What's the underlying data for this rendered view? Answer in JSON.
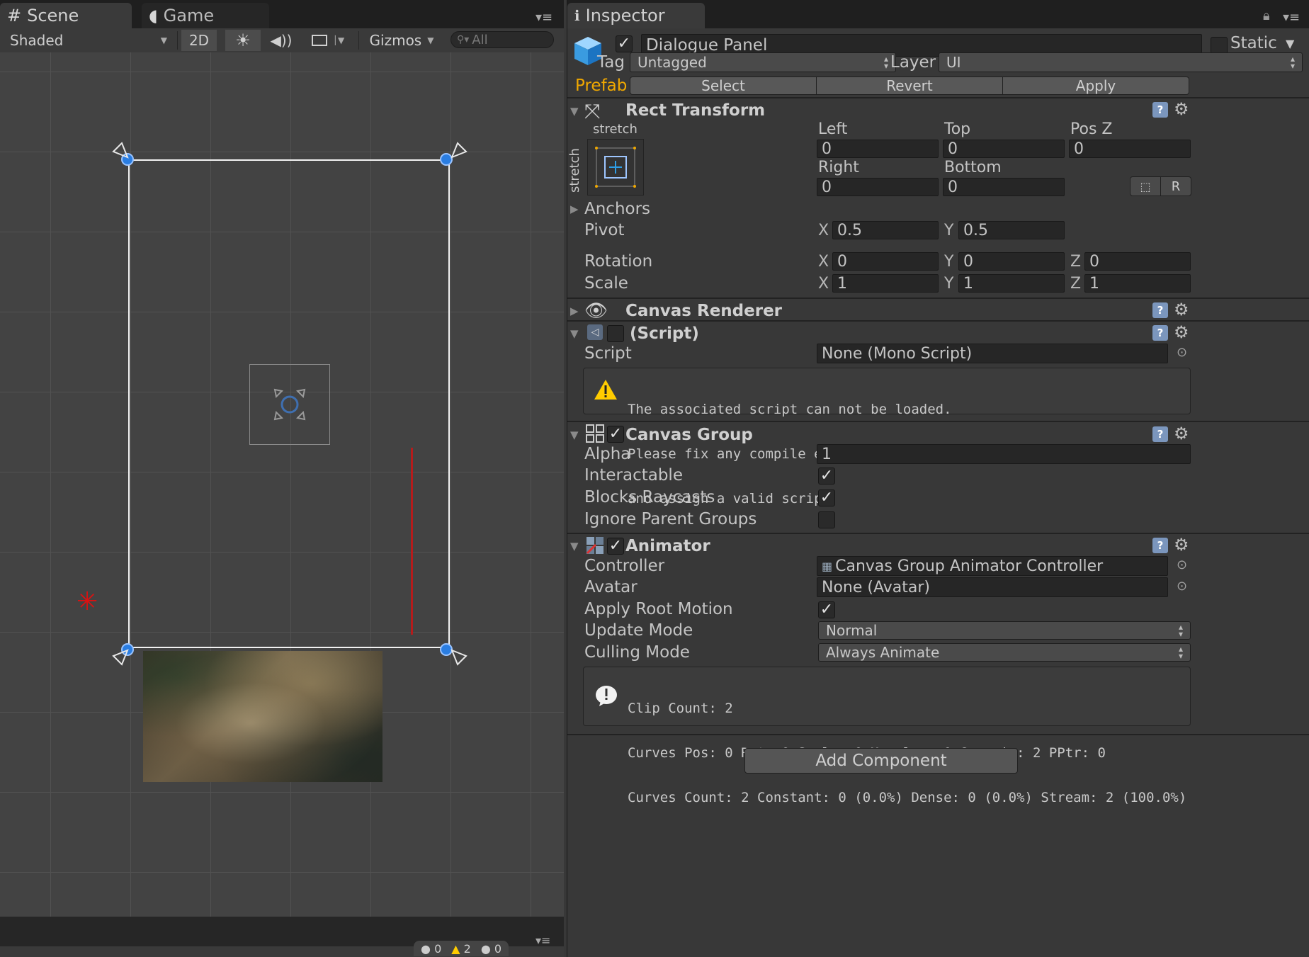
{
  "scene": {
    "tabs": [
      {
        "label": "Scene",
        "icon": "grid-icon"
      },
      {
        "label": "Game",
        "icon": "pacman-icon"
      }
    ],
    "toolbar": {
      "shading_mode": "Shaded",
      "mode_2d": "2D",
      "gizmos": "Gizmos",
      "search_placeholder": "All"
    },
    "status": {
      "errors": "0",
      "warnings": "2",
      "messages": "0"
    }
  },
  "inspector": {
    "tab_label": "Inspector",
    "object": {
      "active": true,
      "name": "Dialogue Panel",
      "static_label": "Static",
      "static": false,
      "tag_label": "Tag",
      "tag_value": "Untagged",
      "layer_label": "Layer",
      "layer_value": "UI"
    },
    "prefab": {
      "label": "Prefab",
      "select": "Select",
      "revert": "Revert",
      "apply": "Apply"
    },
    "rect_transform": {
      "title": "Rect Transform",
      "anchor_preset_top": "stretch",
      "anchor_preset_side": "stretch",
      "left_label": "Left",
      "left": "0",
      "top_label": "Top",
      "top": "0",
      "posz_label": "Pos Z",
      "posz": "0",
      "right_label": "Right",
      "right": "0",
      "bottom_label": "Bottom",
      "bottom": "0",
      "raw_button": "R",
      "anchors_label": "Anchors",
      "pivot_label": "Pivot",
      "pivot_x": "0.5",
      "pivot_y": "0.5",
      "rotation_label": "Rotation",
      "rot_x": "0",
      "rot_y": "0",
      "rot_z": "0",
      "scale_label": "Scale",
      "scale_x": "1",
      "scale_y": "1",
      "scale_z": "1",
      "x": "X",
      "y": "Y",
      "z": "Z"
    },
    "canvas_renderer": {
      "title": "Canvas Renderer"
    },
    "script_component": {
      "title": "(Script)",
      "script_label": "Script",
      "script_value": "None (Mono Script)",
      "warning_lines": [
        "The associated script can not be loaded.",
        "Please fix any compile errors",
        "and assign a valid script."
      ]
    },
    "canvas_group": {
      "title": "Canvas Group",
      "alpha_label": "Alpha",
      "alpha": "1",
      "interactable_label": "Interactable",
      "interactable": true,
      "blocks_raycasts_label": "Blocks Raycasts",
      "blocks_raycasts": true,
      "ignore_parent_label": "Ignore Parent Groups",
      "ignore_parent": false
    },
    "animator": {
      "title": "Animator",
      "controller_label": "Controller",
      "controller_value": "Canvas Group Animator Controller",
      "avatar_label": "Avatar",
      "avatar_value": "None (Avatar)",
      "apply_root_motion_label": "Apply Root Motion",
      "apply_root_motion": true,
      "update_mode_label": "Update Mode",
      "update_mode": "Normal",
      "culling_mode_label": "Culling Mode",
      "culling_mode": "Always Animate",
      "info_lines": [
        "Clip Count: 2",
        "Curves Pos: 0 Rot: 0 Scale: 0 Muscles: 0 Generic: 2 PPtr: 0",
        "Curves Count: 2 Constant: 0 (0.0%) Dense: 0 (0.0%) Stream: 2 (100.0%)"
      ]
    },
    "add_component": "Add Component"
  },
  "colors": {
    "prefab_label": "#f0a800",
    "selection_handle": "#2a7de1",
    "warning": "#ffcc00",
    "help_icon": "#7b96bd"
  }
}
